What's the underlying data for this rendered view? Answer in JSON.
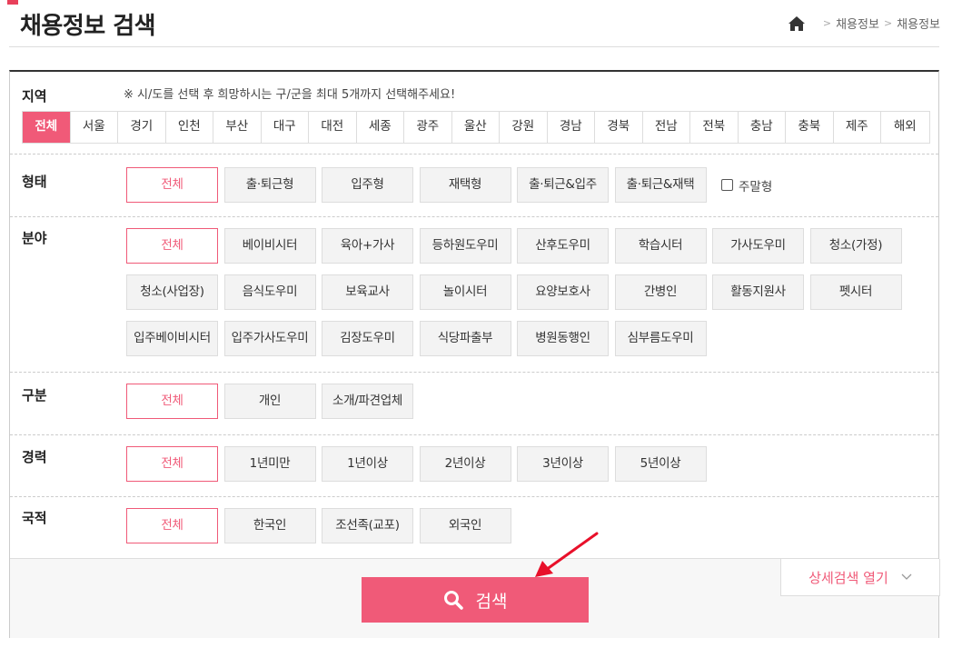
{
  "header": {
    "title": "채용정보 검색",
    "breadcrumb": [
      "채용정보",
      "채용정보"
    ]
  },
  "region": {
    "label": "지역",
    "note": "※ 시/도를 선택 후 희망하시는 구/군을 최대 5개까지 선택해주세요!",
    "tabs": [
      "전체",
      "서울",
      "경기",
      "인천",
      "부산",
      "대구",
      "대전",
      "세종",
      "광주",
      "울산",
      "강원",
      "경남",
      "경북",
      "전남",
      "전북",
      "충남",
      "충북",
      "제주",
      "해외"
    ],
    "selected": "전체"
  },
  "form_type": {
    "label": "형태",
    "options": [
      "전체",
      "출·퇴근형",
      "입주형",
      "재택형",
      "출·퇴근&입주",
      "출·퇴근&재택"
    ],
    "checkbox_label": "주말형"
  },
  "field": {
    "label": "분야",
    "options": [
      "전체",
      "베이비시터",
      "육아+가사",
      "등하원도우미",
      "산후도우미",
      "학습시터",
      "가사도우미",
      "청소(가정)",
      "청소(사업장)",
      "음식도우미",
      "보육교사",
      "놀이시터",
      "요양보호사",
      "간병인",
      "활동지원사",
      "펫시터",
      "입주베이비시터",
      "입주가사도우미",
      "김장도우미",
      "식당파출부",
      "병원동행인",
      "심부름도우미"
    ]
  },
  "category": {
    "label": "구분",
    "options": [
      "전체",
      "개인",
      "소개/파견업체"
    ]
  },
  "career": {
    "label": "경력",
    "options": [
      "전체",
      "1년미만",
      "1년이상",
      "2년이상",
      "3년이상",
      "5년이상"
    ]
  },
  "nationality": {
    "label": "국적",
    "options": [
      "전체",
      "한국인",
      "조선족(교포)",
      "외국인"
    ]
  },
  "actions": {
    "search_label": "검색",
    "detail_label": "상세검색 열기"
  },
  "colors": {
    "accent": "#f05a78",
    "arrow": "#e8102a"
  }
}
